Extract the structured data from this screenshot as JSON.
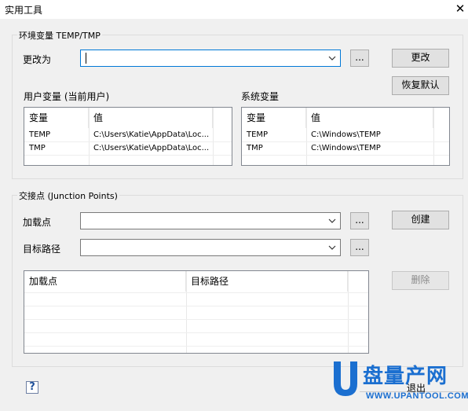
{
  "window": {
    "title": "实用工具",
    "close_glyph": "✕"
  },
  "env": {
    "legend": "环境变量 TEMP/TMP",
    "change_to_label": "更改为",
    "change_to_value": "",
    "browse_label": "...",
    "change_button": "更改",
    "restore_button": "恢复默认",
    "user_vars": {
      "heading": "用户变量 (当前用户)",
      "columns": [
        "变量",
        "值"
      ],
      "rows": [
        [
          "TEMP",
          "C:\\Users\\Katie\\AppData\\Loc..."
        ],
        [
          "TMP",
          "C:\\Users\\Katie\\AppData\\Loc..."
        ]
      ]
    },
    "system_vars": {
      "heading": "系统变量",
      "columns": [
        "变量",
        "值"
      ],
      "rows": [
        [
          "TEMP",
          "C:\\Windows\\TEMP"
        ],
        [
          "TMP",
          "C:\\Windows\\TEMP"
        ]
      ]
    }
  },
  "junction": {
    "legend": "交接点 (Junction Points)",
    "mount_label": "加载点",
    "target_label": "目标路径",
    "browse_label": "...",
    "create_button": "创建",
    "delete_button": "删除",
    "columns": [
      "加载点",
      "目标路径"
    ]
  },
  "footer": {
    "help_glyph": "?",
    "exit_button": "退出"
  },
  "watermark": {
    "brand_cn": "盘量产网",
    "url": "WWW.UPANTOOL.COM",
    "color_blue": "#1b6fd0",
    "color_red": "#d9261c"
  }
}
